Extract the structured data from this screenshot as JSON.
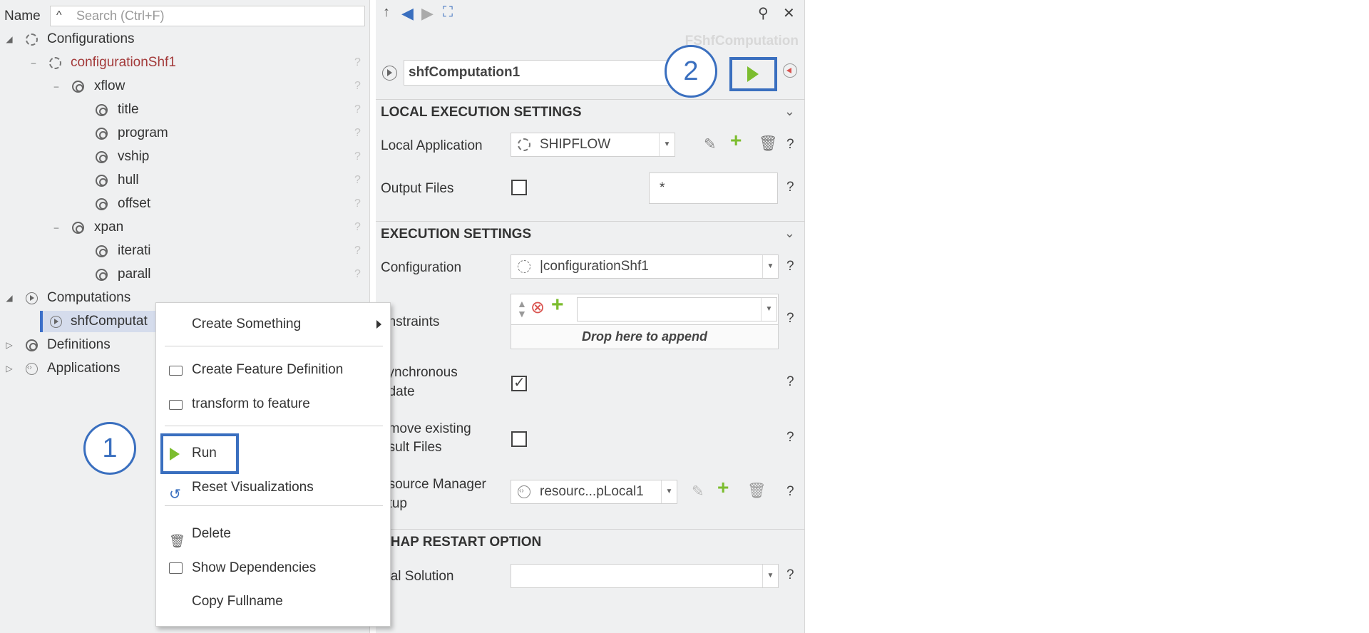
{
  "tree": {
    "name_label": "Name",
    "search_placeholder": "Search (Ctrl+F)",
    "rows": [
      {
        "label": "Configurations",
        "expander": "◢",
        "icon": "config-icon"
      },
      {
        "label": "configurationShf1",
        "expander": "–",
        "icon": "config-icon"
      },
      {
        "label": "xflow",
        "expander": "–",
        "icon": "feature-icon"
      },
      {
        "label": "title",
        "icon": "feature-icon"
      },
      {
        "label": "program",
        "icon": "feature-icon"
      },
      {
        "label": "vship",
        "icon": "feature-icon"
      },
      {
        "label": "hull",
        "icon": "feature-icon"
      },
      {
        "label": "offset",
        "icon": "feature-icon"
      },
      {
        "label": "xpan",
        "expander": "–",
        "icon": "feature-icon"
      },
      {
        "label": "iterati",
        "icon": "feature-icon"
      },
      {
        "label": "parall",
        "icon": "feature-icon"
      },
      {
        "label": "Computations",
        "expander": "◢",
        "icon": "computation-icon"
      },
      {
        "label": "shfComputat",
        "icon": "computation-icon"
      },
      {
        "label": "Definitions",
        "expander": "▷",
        "icon": "feature-icon"
      },
      {
        "label": "Applications",
        "expander": "▷",
        "icon": "application-icon"
      }
    ],
    "help_mark": "?"
  },
  "panel": {
    "title": "FShfComputation",
    "name_value": "shfComputation1",
    "local_execution": {
      "header": "LOCAL EXECUTION SETTINGS",
      "local_application_label": "Local Application",
      "local_application_value": "SHIPFLOW",
      "output_files_label": "Output Files",
      "output_files_checked": false,
      "output_files_pattern": "*"
    },
    "execution": {
      "header": "EXECUTION SETTINGS",
      "configuration_label": "Configuration",
      "configuration_value": "|configurationShf1",
      "constraints_label": "onstraints",
      "drop_text": "Drop here to append",
      "sync_update_label_1": "synchronous",
      "sync_update_label_2": "pdate",
      "sync_update_checked": true,
      "remove_files_label_1": "emove existing",
      "remove_files_label_2": "esult Files",
      "remove_files_checked": false,
      "resource_label_1": "esource Manager",
      "resource_label_2": "etup",
      "resource_value": "resourc...pLocal1"
    },
    "restart": {
      "header": "CHAP RESTART OPTION",
      "initial_solution_label": "itial Solution",
      "initial_solution_value": ""
    },
    "help_mark": "?"
  },
  "context_menu": {
    "items": [
      {
        "label": "Create Something",
        "has_submenu": true
      },
      {
        "label": "Create Feature Definition"
      },
      {
        "label": "transform to feature"
      },
      {
        "label": "Run"
      },
      {
        "label": "Reset Visualizations"
      },
      {
        "label": "Delete"
      },
      {
        "label": "Show Dependencies"
      },
      {
        "label": "Copy Fullname"
      }
    ]
  },
  "callouts": {
    "one": "1",
    "two": "2"
  },
  "colors": {
    "accent": "#3a6fbf",
    "run_green": "#7cbd2f",
    "panel_bg": "#eff0f1",
    "config_red": "#a33a3a"
  }
}
